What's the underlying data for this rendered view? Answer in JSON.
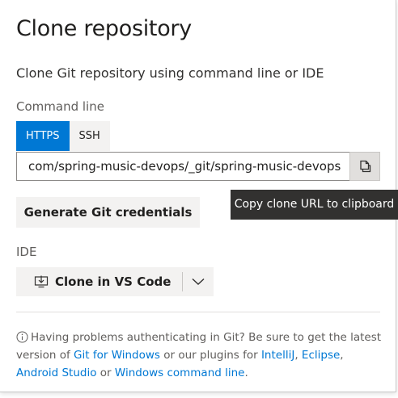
{
  "dialog": {
    "title": "Clone repository",
    "subtitle": "Clone Git repository using command line or IDE"
  },
  "command_line": {
    "label": "Command line",
    "tabs": [
      {
        "label": "HTTPS",
        "active": true
      },
      {
        "label": "SSH",
        "active": false
      }
    ],
    "url_value": "com/spring-music-devops/_git/spring-music-devops",
    "copy_icon": "copy-icon",
    "tooltip": "Copy clone URL to clipboard",
    "generate_label": "Generate Git credentials"
  },
  "ide": {
    "label": "IDE",
    "clone_label": "Clone in VS Code",
    "clone_icon": "download-to-computer-icon",
    "dropdown_icon": "chevron-down-icon"
  },
  "help": {
    "info_icon": "info-icon",
    "text_1": "Having problems authenticating in Git? Be sure to get the latest version of ",
    "link_git_windows": "Git for Windows",
    "text_2": " or our plugins for ",
    "link_intellij": "IntelliJ",
    "text_3": ", ",
    "link_eclipse": "Eclipse",
    "text_4": ", ",
    "link_android": "Android Studio",
    "text_5": " or ",
    "link_cmdline": "Windows command line",
    "text_6": "."
  },
  "colors": {
    "accent": "#0078d4",
    "tooltip_bg": "#323130",
    "button_bg": "#f3f2f1"
  }
}
